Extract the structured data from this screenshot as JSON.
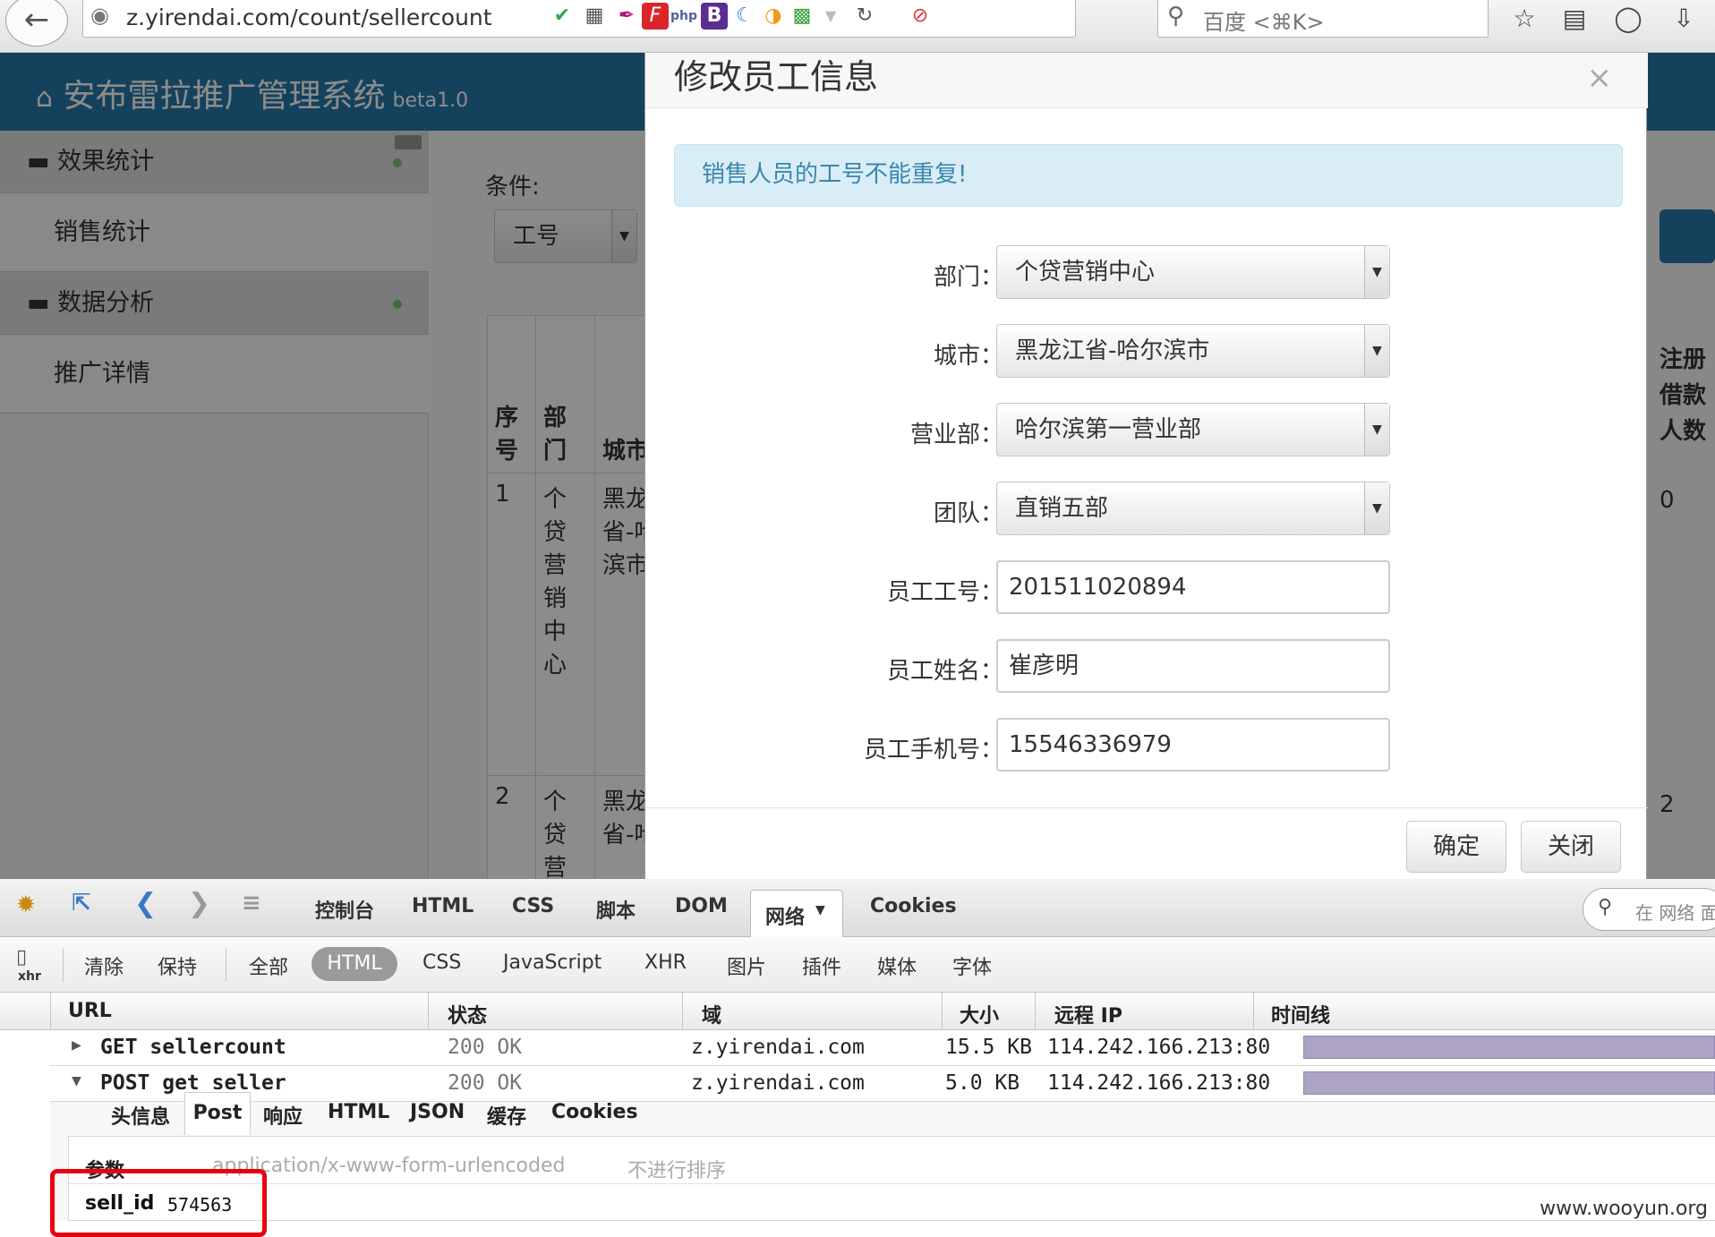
{
  "browser": {
    "url": "z.yirendai.com/count/sellercount",
    "search_placeholder": "百度 <⌘K>",
    "ext_php": "php",
    "ext_b": "B"
  },
  "app": {
    "title": "安布雷拉推广管理系统",
    "version": "beta1.0"
  },
  "sidebar": {
    "groups": [
      {
        "label": "效果统计",
        "item": "销售统计"
      },
      {
        "label": "数据分析",
        "item": "推广详情"
      }
    ]
  },
  "main": {
    "condition_label": "条件:",
    "condition_value": "工号",
    "table": {
      "headers": [
        "序号",
        "部门",
        "城市"
      ],
      "right_header": "注册借款人数",
      "rows": [
        {
          "no": "1",
          "dept": "个贷营销中心",
          "city": "黑龙江省-哈尔滨市",
          "right": "0"
        },
        {
          "no": "2",
          "dept": "个贷营",
          "city": "黑龙江省-哈",
          "right": "2"
        }
      ]
    }
  },
  "modal": {
    "title": "修改员工信息",
    "close_symbol": "×",
    "alert": "销售人员的工号不能重复!",
    "fields": {
      "dept": {
        "label": "部门：",
        "value": "个贷营销中心"
      },
      "city": {
        "label": "城市：",
        "value": "黑龙江省-哈尔滨市"
      },
      "branch": {
        "label": "营业部：",
        "value": "哈尔滨第一营业部"
      },
      "team": {
        "label": "团队：",
        "value": "直销五部"
      },
      "emp_no": {
        "label": "员工工号：",
        "value": "201511020894"
      },
      "emp_name": {
        "label": "员工姓名：",
        "value": "崔彦明"
      },
      "emp_phone": {
        "label": "员工手机号：",
        "value": "15546336979"
      }
    },
    "confirm": "确定",
    "close": "关闭"
  },
  "firebug": {
    "tabs": [
      "控制台",
      "HTML",
      "CSS",
      "脚本",
      "DOM",
      "网络",
      "Cookies"
    ],
    "search_placeholder": "在 网络 面",
    "filters": {
      "clear": "清除",
      "persist": "保持",
      "items": [
        "全部",
        "HTML",
        "CSS",
        "JavaScript",
        "XHR",
        "图片",
        "插件",
        "媒体",
        "字体"
      ]
    },
    "xhr_label": "xhr",
    "columns": {
      "url": "URL",
      "status": "状态",
      "domain": "域",
      "size": "大小",
      "remote_ip": "远程 IP",
      "timeline": "时间线"
    },
    "requests": [
      {
        "url": "GET sellercount",
        "status": "200 OK",
        "domain": "z.yirendai.com",
        "size": "15.5 KB",
        "ip": "114.242.166.213:80"
      },
      {
        "url": "POST get_seller",
        "status": "200 OK",
        "domain": "z.yirendai.com",
        "size": "5.0 KB",
        "ip": "114.242.166.213:80"
      }
    ],
    "subtabs": [
      "头信息",
      "Post",
      "响应",
      "HTML",
      "JSON",
      "缓存",
      "Cookies"
    ],
    "params": {
      "label": "参数",
      "content_type": "application/x-www-form-urlencoded",
      "sort": "不进行排序",
      "name": "sell_id",
      "value": "574563"
    }
  },
  "watermark": "www.wooyun.org",
  "colors": {
    "header_blue": "#2679a9",
    "alert_bg": "#d9edf7",
    "highlight_red": "#e60012",
    "timeline_bar": "#ada3c5"
  }
}
